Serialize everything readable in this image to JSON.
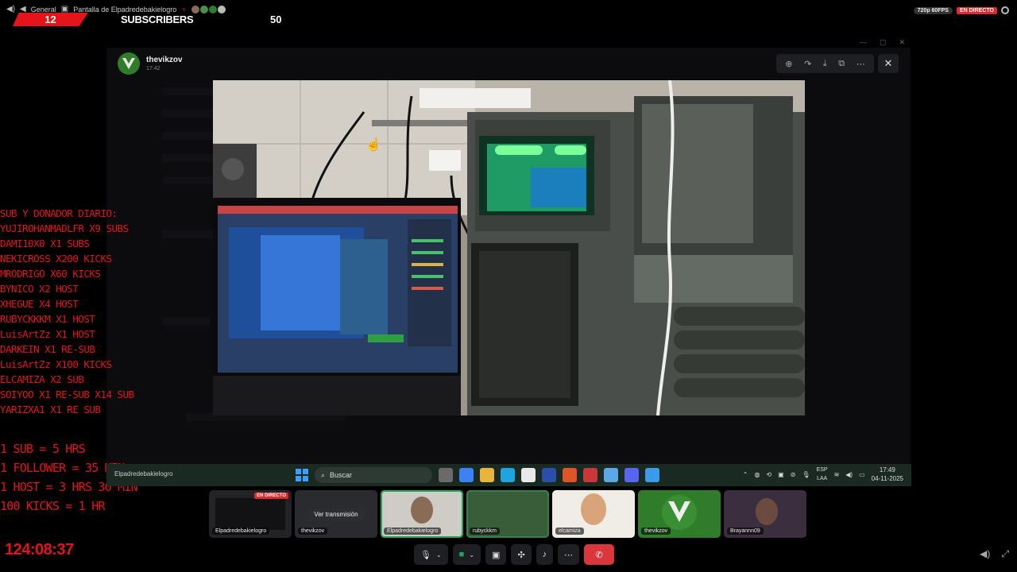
{
  "topbar": {
    "channel": "General",
    "screen_share": "Pantalla de Elpadredebakielogro",
    "quality": "720p 60FPS",
    "live": "EN DIRECTO"
  },
  "sub_overlay": {
    "current": "12",
    "label": "SUBSCRIBERS",
    "goal": "50"
  },
  "viewer": {
    "user": "thevikzov",
    "time": "17:42"
  },
  "donors": [
    "SUB Y DONADOR DIARIO:",
    "YUJIROHANMADLFR X9 SUBS",
    "DAMI10X0 X1 SUBS",
    "NEKICROSS X200 KICKS",
    "MRODRIGO X60 KICKS",
    "BYNICO X2 HOST",
    "XHEGUE X4 HOST",
    "RUBYCKKKM X1 HOST",
    "LuisArtZz X1 HOST",
    "DARKEIN X1 RE-SUB",
    "LuisArtZz X100 KICKS",
    "ELCAMIZA X2 SUB",
    "SOIYOO X1 RE-SUB X14 SUB",
    "YARIZXA1 X1 RE SUB"
  ],
  "rates": [
    "1 SUB = 5 HRS",
    "1 FOLLOWER = 35 MIN",
    "1 HOST = 3 HRS 30 MIN",
    "100 KICKS = 1 HR"
  ],
  "timer": "124:08:37",
  "taskbar": {
    "user": "Elpadredebakielogro",
    "search_placeholder": "Buscar",
    "lang_top": "ESP",
    "lang_bottom": "LAA",
    "time": "17:49",
    "date": "04-11-2025"
  },
  "tiles": [
    {
      "name": "Elpadredebakielogro",
      "live": "EN DIRECTO"
    },
    {
      "name": "thevikzov",
      "button": "Ver transmisión"
    },
    {
      "name": "Elpadredebakielogro"
    },
    {
      "name": "rubyckkm"
    },
    {
      "name": "elcamiza"
    },
    {
      "name": "thevikzov"
    },
    {
      "name": "Brayannn09"
    }
  ],
  "colors": {
    "overlay_red": "#e5141b",
    "discord_dark": "#1e1f22",
    "hangup": "#da373c",
    "speaking": "#23a55a"
  }
}
